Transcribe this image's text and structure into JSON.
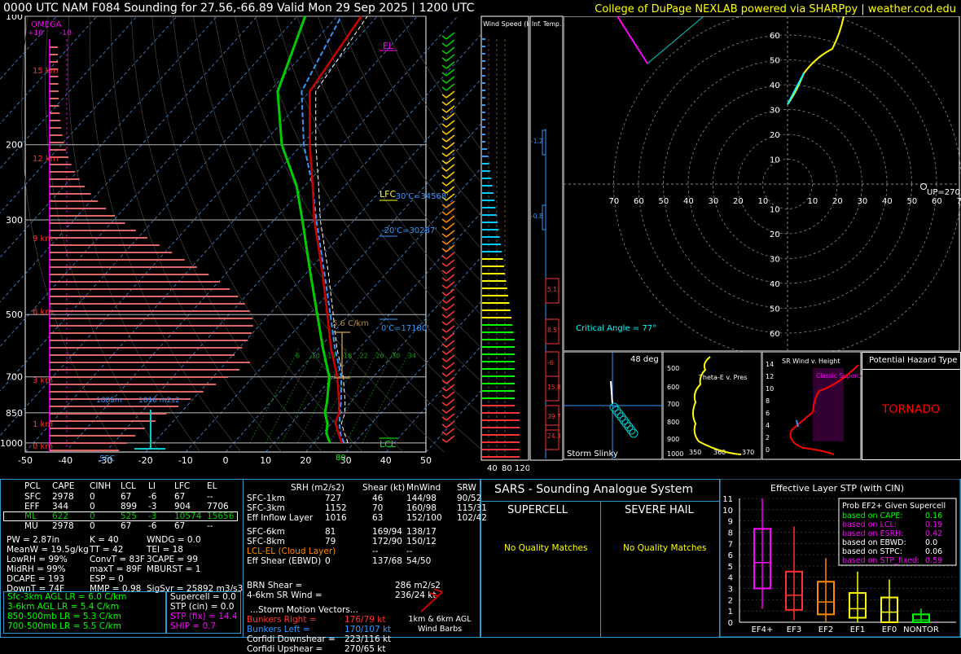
{
  "header": {
    "title": "0000 UTC NAM F084 Sounding for 27.56,-66.89 Valid  Mon 29 Sep 2025 | 1200 UTC",
    "credit": "College of DuPage NEXLAB powered via SHARPpy | weather.cod.edu"
  },
  "colors": {
    "temperature": "#cc0000",
    "dewpoint": "#00cc00",
    "wetbulb": "#00ffff",
    "parcel": "#ffffff",
    "accent": "#3399ff",
    "panel_border": "#3399cc"
  },
  "chart_data": [
    {
      "type": "line",
      "name": "skew-t",
      "ylabel": "",
      "yticks": [
        100,
        200,
        300,
        500,
        700,
        850,
        1000
      ],
      "xticks": [
        -50,
        -40,
        -30,
        -20,
        -10,
        0,
        10,
        20,
        30,
        40,
        50
      ],
      "omega_label": "OMEGA",
      "omega_ticks": [
        "+10",
        "-10"
      ],
      "height_labels": [
        "15 km",
        "12 km",
        "9 km",
        "6 km",
        "3 km",
        "1 km",
        "0 km"
      ],
      "level_labels": {
        "el": "EL",
        "lfc": "LFC",
        "lcl": "LCL",
        "sfc": "SFC",
        "wetbulb_zero": "0'C=17180'",
        "m20": "-20'C=30287'",
        "m30": "-30'C=34568'",
        "lapse": "5.6 C/km"
      },
      "hodo_marks": {
        "low": "1885m",
        "mid": "1016 m2s2"
      },
      "mixing_ratio_labels": [
        "6",
        "10",
        "14",
        "18",
        "22",
        "26",
        "30",
        "34"
      ],
      "sfc_temp_label": "80",
      "series": [
        {
          "name": "Temperature",
          "p": [
            1000,
            950,
            900,
            850,
            800,
            700,
            600,
            500,
            400,
            300,
            250,
            200,
            150,
            100
          ],
          "t": [
            27,
            24,
            21,
            19.5,
            17,
            11,
            3,
            -5.5,
            -16,
            -30,
            -38,
            -48,
            -60,
            -64
          ]
        },
        {
          "name": "Dewpoint",
          "p": [
            1000,
            950,
            900,
            850,
            800,
            700,
            600,
            500,
            400,
            300,
            250,
            200,
            150,
            100
          ],
          "t": [
            24,
            21,
            19,
            16,
            14,
            9,
            1,
            -8,
            -19,
            -33,
            -42,
            -55,
            -68,
            -78
          ]
        }
      ]
    },
    {
      "type": "bar",
      "name": "wind-speed",
      "title": "Wind Speed (knots)",
      "xticks": [
        "40",
        "80",
        "120"
      ]
    },
    {
      "type": "line",
      "name": "inferred-temp-advection",
      "title": "Inf. Temp. Adv. (C/hr)",
      "labels": [
        "-1.2",
        "-0.8",
        "5.1",
        "8.5",
        "-6",
        "15.8",
        "39.7",
        "24.3"
      ]
    },
    {
      "type": "scatter",
      "name": "hodograph",
      "rings": [
        "60",
        "50",
        "40",
        "30",
        "20",
        "10"
      ],
      "xticks": [
        "70",
        "60",
        "50",
        "40",
        "30",
        "20",
        "10",
        "10",
        "20",
        "30",
        "40",
        "50",
        "60",
        "70"
      ],
      "motion_label": "UP=270",
      "critical_angle": "Critical Angle = 77°"
    }
  ],
  "insets": {
    "storm_slinky": {
      "title": "Storm Slinky",
      "deg": "48 deg"
    },
    "theta_e": {
      "title": "Theta-E v. Pres",
      "yticks": [
        "500",
        "600",
        "700",
        "800",
        "900",
        "1000"
      ],
      "xticks": [
        "350",
        "360",
        "370"
      ]
    },
    "sr_wind": {
      "title": "SR Wind v. Height",
      "yticks": [
        "14",
        "12",
        "10",
        "8",
        "6",
        "4",
        "2",
        "0"
      ],
      "badge": "Classic Supercell"
    },
    "hazard": {
      "title": "Potential Hazard Type",
      "value": "TORNADO"
    }
  },
  "parcels": {
    "header": [
      "PCL",
      "CAPE",
      "CINH",
      "LCL",
      "LI",
      "LFC",
      "EL"
    ],
    "rows": [
      [
        "SFC",
        "2978",
        "0",
        "67",
        "-6",
        "67",
        "--"
      ],
      [
        "EFF",
        "344",
        "0",
        "899",
        "-3",
        "904",
        "7706"
      ],
      [
        "ML",
        "622",
        "0",
        "525",
        "-3",
        "10574",
        "15656"
      ],
      [
        "MU",
        "2978",
        "0",
        "67",
        "-6",
        "67",
        "--"
      ]
    ]
  },
  "indices": {
    "left": [
      "PW = 2.87in",
      "MeanW = 19.5g/kg",
      "LowRH = 99%",
      "MidRH = 99%",
      "DCAPE = 193",
      "DownT = 74F"
    ],
    "mid": [
      "K = 40",
      "TT = 42",
      "ConvT = 83F",
      "maxT = 89F",
      "ESP = 0",
      "MMP = 0.98"
    ],
    "right": [
      "WNDG = 0.0",
      "TEI = 18",
      "3CAPE = 99",
      "MBURST = 1",
      "",
      "SigSvr = 25892 m3/s3"
    ]
  },
  "lapse": [
    "Sfc-3km AGL LR = 6.0 C/km",
    "3-6km AGL LR = 5.4 C/km",
    "850-500mb LR = 5.3 C/km",
    "700-500mb LR = 5.5 C/km"
  ],
  "params": [
    "Supercell = 0.0",
    "STP (cin) = 0.0",
    "STP (fix) = 14.4",
    "SHIP = 0.7"
  ],
  "kinematics": {
    "header": [
      "SRH (m2/s2)",
      "Shear (kt)",
      "MnWind",
      "SRW"
    ],
    "rows": [
      [
        "SFC-1km",
        "727",
        "46",
        "144/98",
        "90/52"
      ],
      [
        "SFC-3km",
        "1152",
        "70",
        "160/98",
        "115/31"
      ],
      [
        "Eff Inflow Layer",
        "1016",
        "63",
        "152/100",
        "102/42"
      ],
      [
        "",
        "",
        "",
        "",
        ""
      ],
      [
        "SFC-6km",
        "81",
        "169/94",
        "138/17",
        ""
      ],
      [
        "SFC-8km",
        "79",
        "172/90",
        "150/12",
        ""
      ],
      [
        "LCL-EL (Cloud Layer)",
        "",
        "--",
        "--",
        ""
      ],
      [
        "Eff Shear (EBWD)",
        "0",
        "137/68",
        "54/50",
        ""
      ]
    ],
    "brn": [
      "BRN Shear =",
      "286 m2/s2"
    ],
    "srwind": [
      "4-6km SR Wind =",
      "236/24 kt"
    ],
    "storm_title": "...Storm Motion Vectors...",
    "motions": [
      [
        "Bunkers Right =",
        "176/79 kt"
      ],
      [
        "Bunkers Left =",
        "170/107 kt"
      ],
      [
        "Corfidi Downshear =",
        "223/116 kt"
      ],
      [
        "Corfidi Upshear =",
        "270/65 kt"
      ]
    ],
    "barbs_label": "1km & 6km AGL Wind Barbs"
  },
  "sars": {
    "title": "SARS - Sounding Analogue System",
    "left_head": "SUPERCELL",
    "right_head": "SEVERE HAIL",
    "left_msg": "No Quality Matches",
    "right_msg": "No Quality Matches"
  },
  "stp": {
    "title": "Effective Layer STP (with CIN)",
    "yticks": [
      "0",
      "1",
      "2",
      "3",
      "4",
      "5",
      "6",
      "7",
      "8",
      "9",
      "10",
      "11"
    ],
    "categories": [
      "EF4+",
      "EF3",
      "EF2",
      "EF1",
      "EF0",
      "NONTOR"
    ],
    "legend_title": "Prob EF2+ Given Supercell",
    "legend": [
      [
        "based on CAPE:",
        "0.16"
      ],
      [
        "based on LCL:",
        "0.19"
      ],
      [
        "based on ESRH:",
        "0.42"
      ],
      [
        "based on EBWD:",
        "0.0"
      ],
      [
        "based on STPC:",
        "0.06"
      ],
      [
        "based on STP_fixed:",
        "0.59"
      ]
    ]
  }
}
